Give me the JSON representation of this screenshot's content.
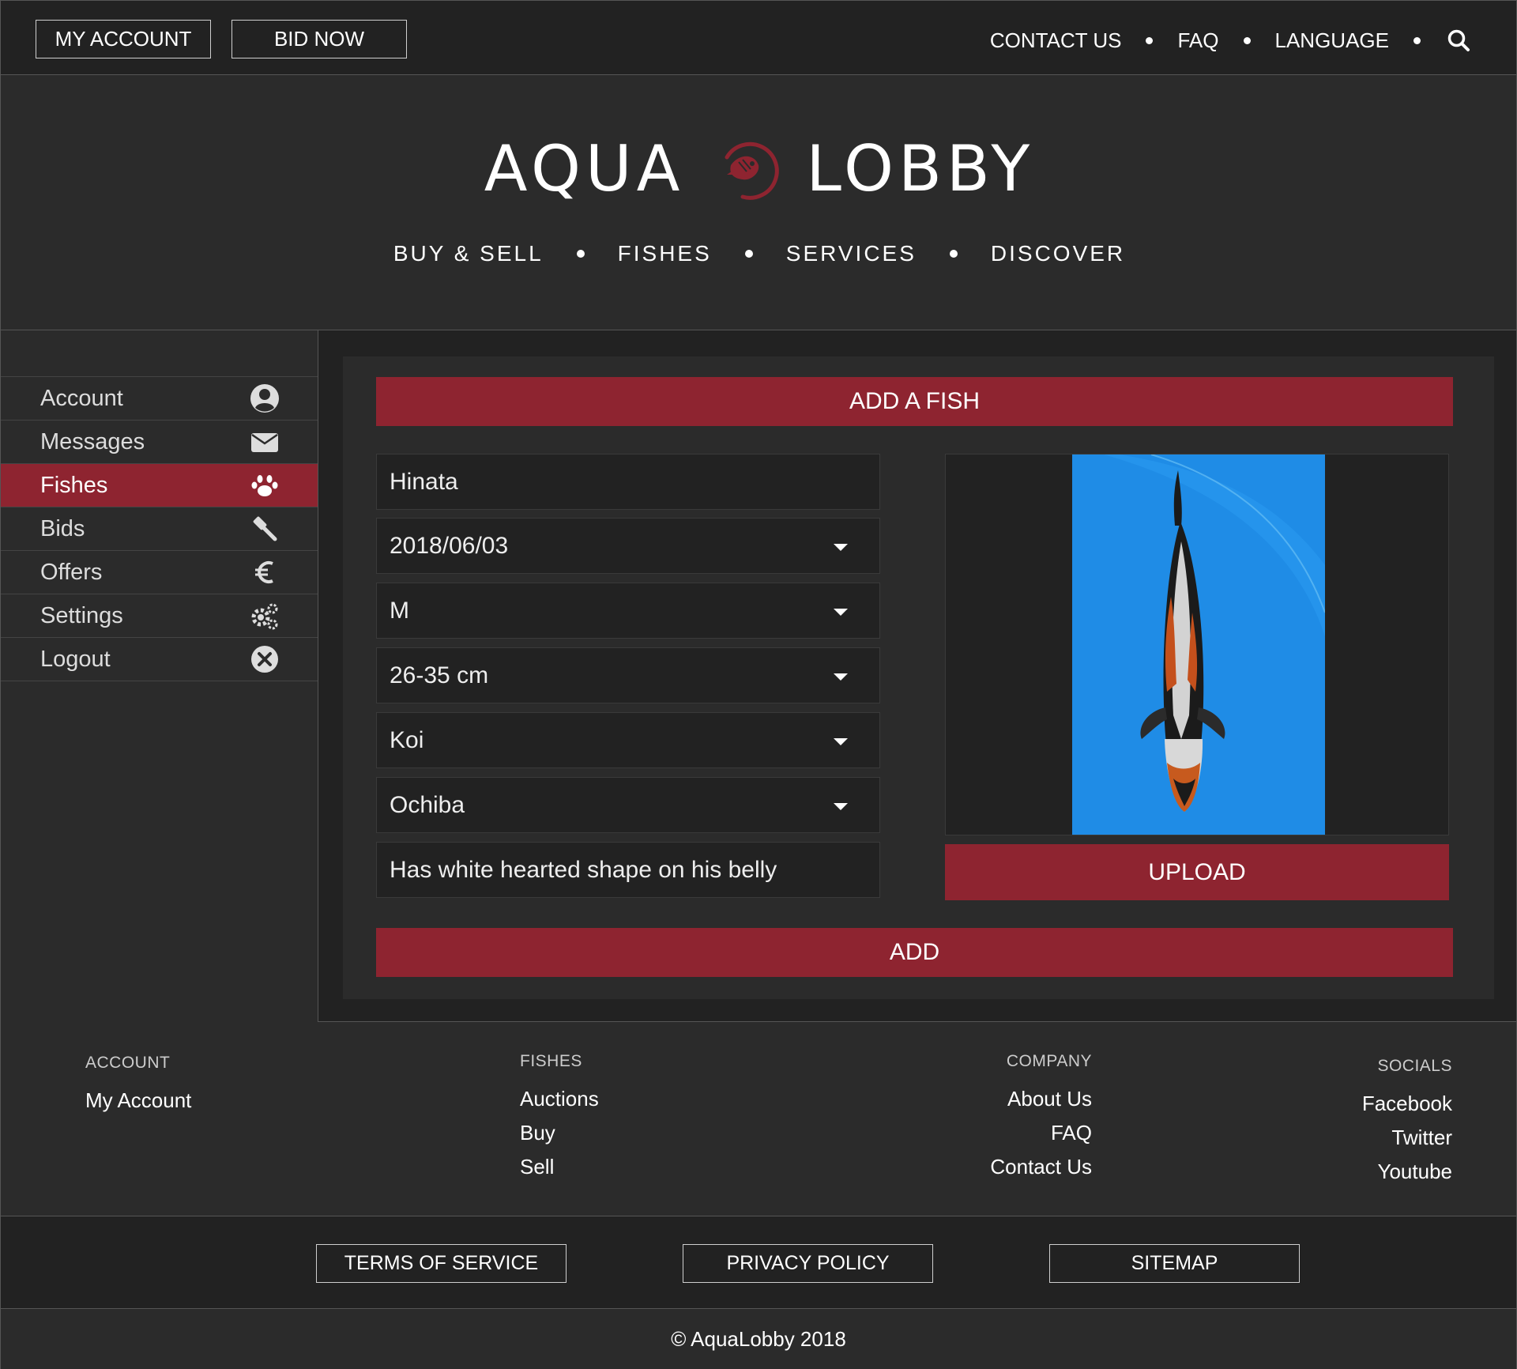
{
  "topbar": {
    "my_account": "MY ACCOUNT",
    "bid_now": "BID NOW",
    "links": [
      "CONTACT US",
      "FAQ",
      "LANGUAGE"
    ],
    "search_icon": "search-icon"
  },
  "header": {
    "logo_left": "AQUA",
    "logo_right": "LOBBY",
    "nav": [
      "BUY & SELL",
      "FISHES",
      "SERVICES",
      "DISCOVER"
    ]
  },
  "sidebar": {
    "items": [
      {
        "label": "Account",
        "icon": "user-circle-icon"
      },
      {
        "label": "Messages",
        "icon": "envelope-icon"
      },
      {
        "label": "Fishes",
        "icon": "paw-icon",
        "active": true
      },
      {
        "label": "Bids",
        "icon": "gavel-icon"
      },
      {
        "label": "Offers",
        "icon": "euro-icon"
      },
      {
        "label": "Settings",
        "icon": "cogs-icon"
      },
      {
        "label": "Logout",
        "icon": "close-circle-icon"
      }
    ]
  },
  "form": {
    "title": "ADD A FISH",
    "name": "Hinata",
    "date": "2018/06/03",
    "gender": "M",
    "size": "26-35 cm",
    "species": "Koi",
    "variety": "Ochiba",
    "description": "Has white hearted shape on his belly",
    "upload_label": "UPLOAD",
    "add_label": "ADD"
  },
  "footer": {
    "account": {
      "heading": "ACCOUNT",
      "links": [
        "My Account"
      ]
    },
    "fishes": {
      "heading": "FISHES",
      "links": [
        "Auctions",
        "Buy",
        "Sell"
      ]
    },
    "company": {
      "heading": "COMPANY",
      "links": [
        "About Us",
        "FAQ",
        "Contact Us"
      ]
    },
    "socials": {
      "heading": "SOCIALS",
      "links": [
        "Facebook",
        "Twitter",
        "Youtube"
      ]
    }
  },
  "legal": {
    "terms": "TERMS OF SERVICE",
    "privacy": "PRIVACY POLICY",
    "sitemap": "SITEMAP"
  },
  "copyright": "© AquaLobby 2018",
  "colors": {
    "accent": "#8e2430",
    "dark_bg": "#222222",
    "panel_bg": "#2b2b2b",
    "text": "#ffffff"
  }
}
